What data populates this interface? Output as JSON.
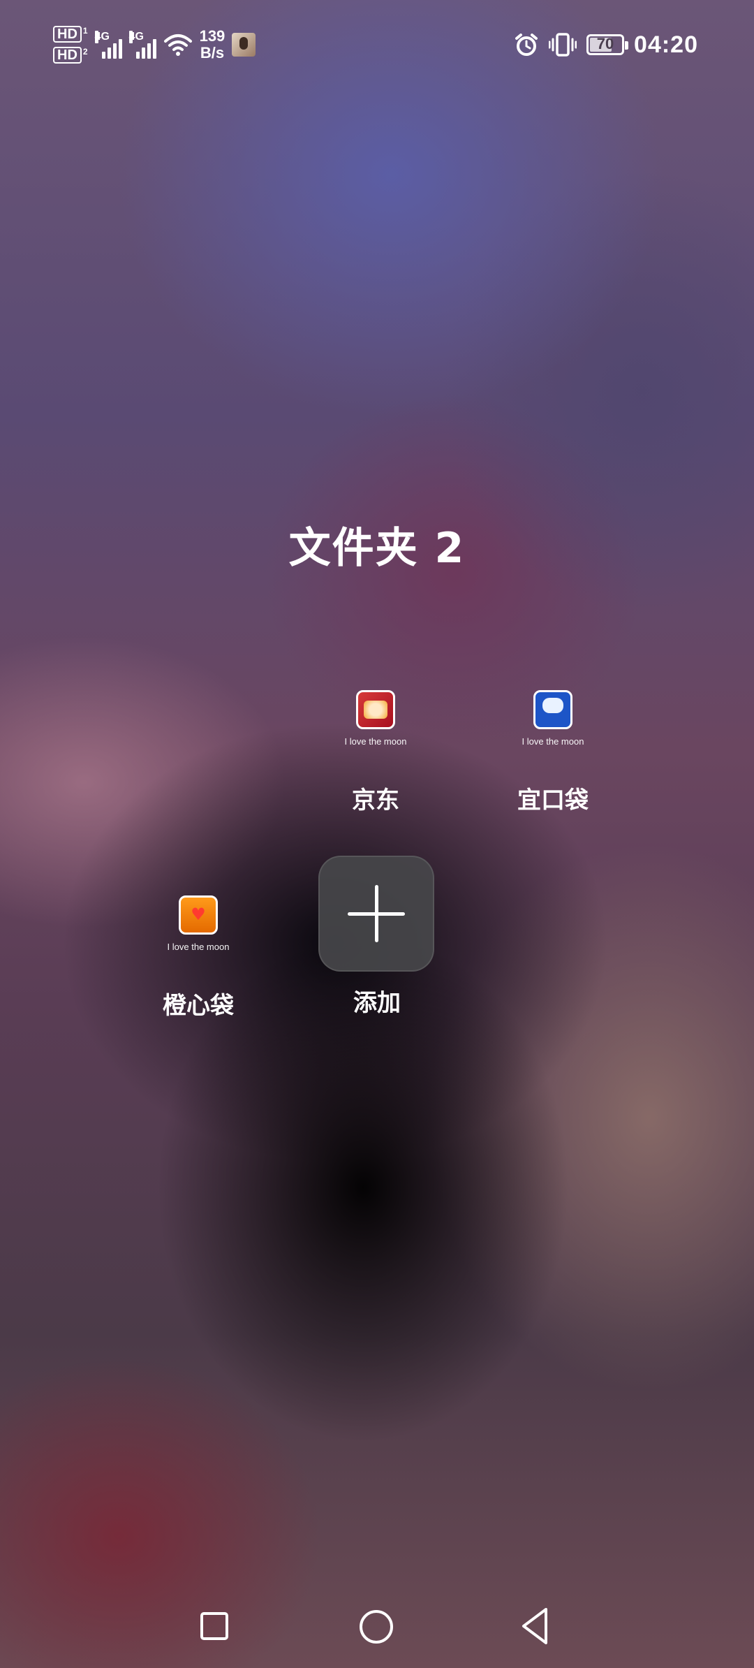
{
  "status_bar": {
    "sim1_label": "HD",
    "sim1_sub": "1",
    "sim2_label": "HD",
    "sim2_sub": "2",
    "network_type_1": "4G",
    "network_type_2": "4G",
    "speed_value": "139",
    "speed_unit": "B/s",
    "battery_percent": "70",
    "time": "04:20",
    "icons": [
      "hd-icon",
      "signal-icon",
      "wifi-icon",
      "avatar",
      "alarm-icon",
      "vibrate-icon",
      "battery-icon"
    ]
  },
  "folder": {
    "title": "文件夹 2",
    "apps": [
      {
        "name": "京东",
        "caption": "I love the moon",
        "icon": "jd-app-icon"
      },
      {
        "name": "宜口袋",
        "caption": "I love the moon",
        "icon": "yikoudai-app-icon"
      },
      {
        "name": "橙心袋",
        "caption": "I love the moon",
        "icon": "chengxindai-app-icon"
      }
    ],
    "add_label": "添加"
  },
  "nav": {
    "buttons": [
      "recent-apps-button",
      "home-button",
      "back-button"
    ]
  },
  "colors": {
    "text": "#ffffff",
    "add_button_bg": "#46464a"
  }
}
